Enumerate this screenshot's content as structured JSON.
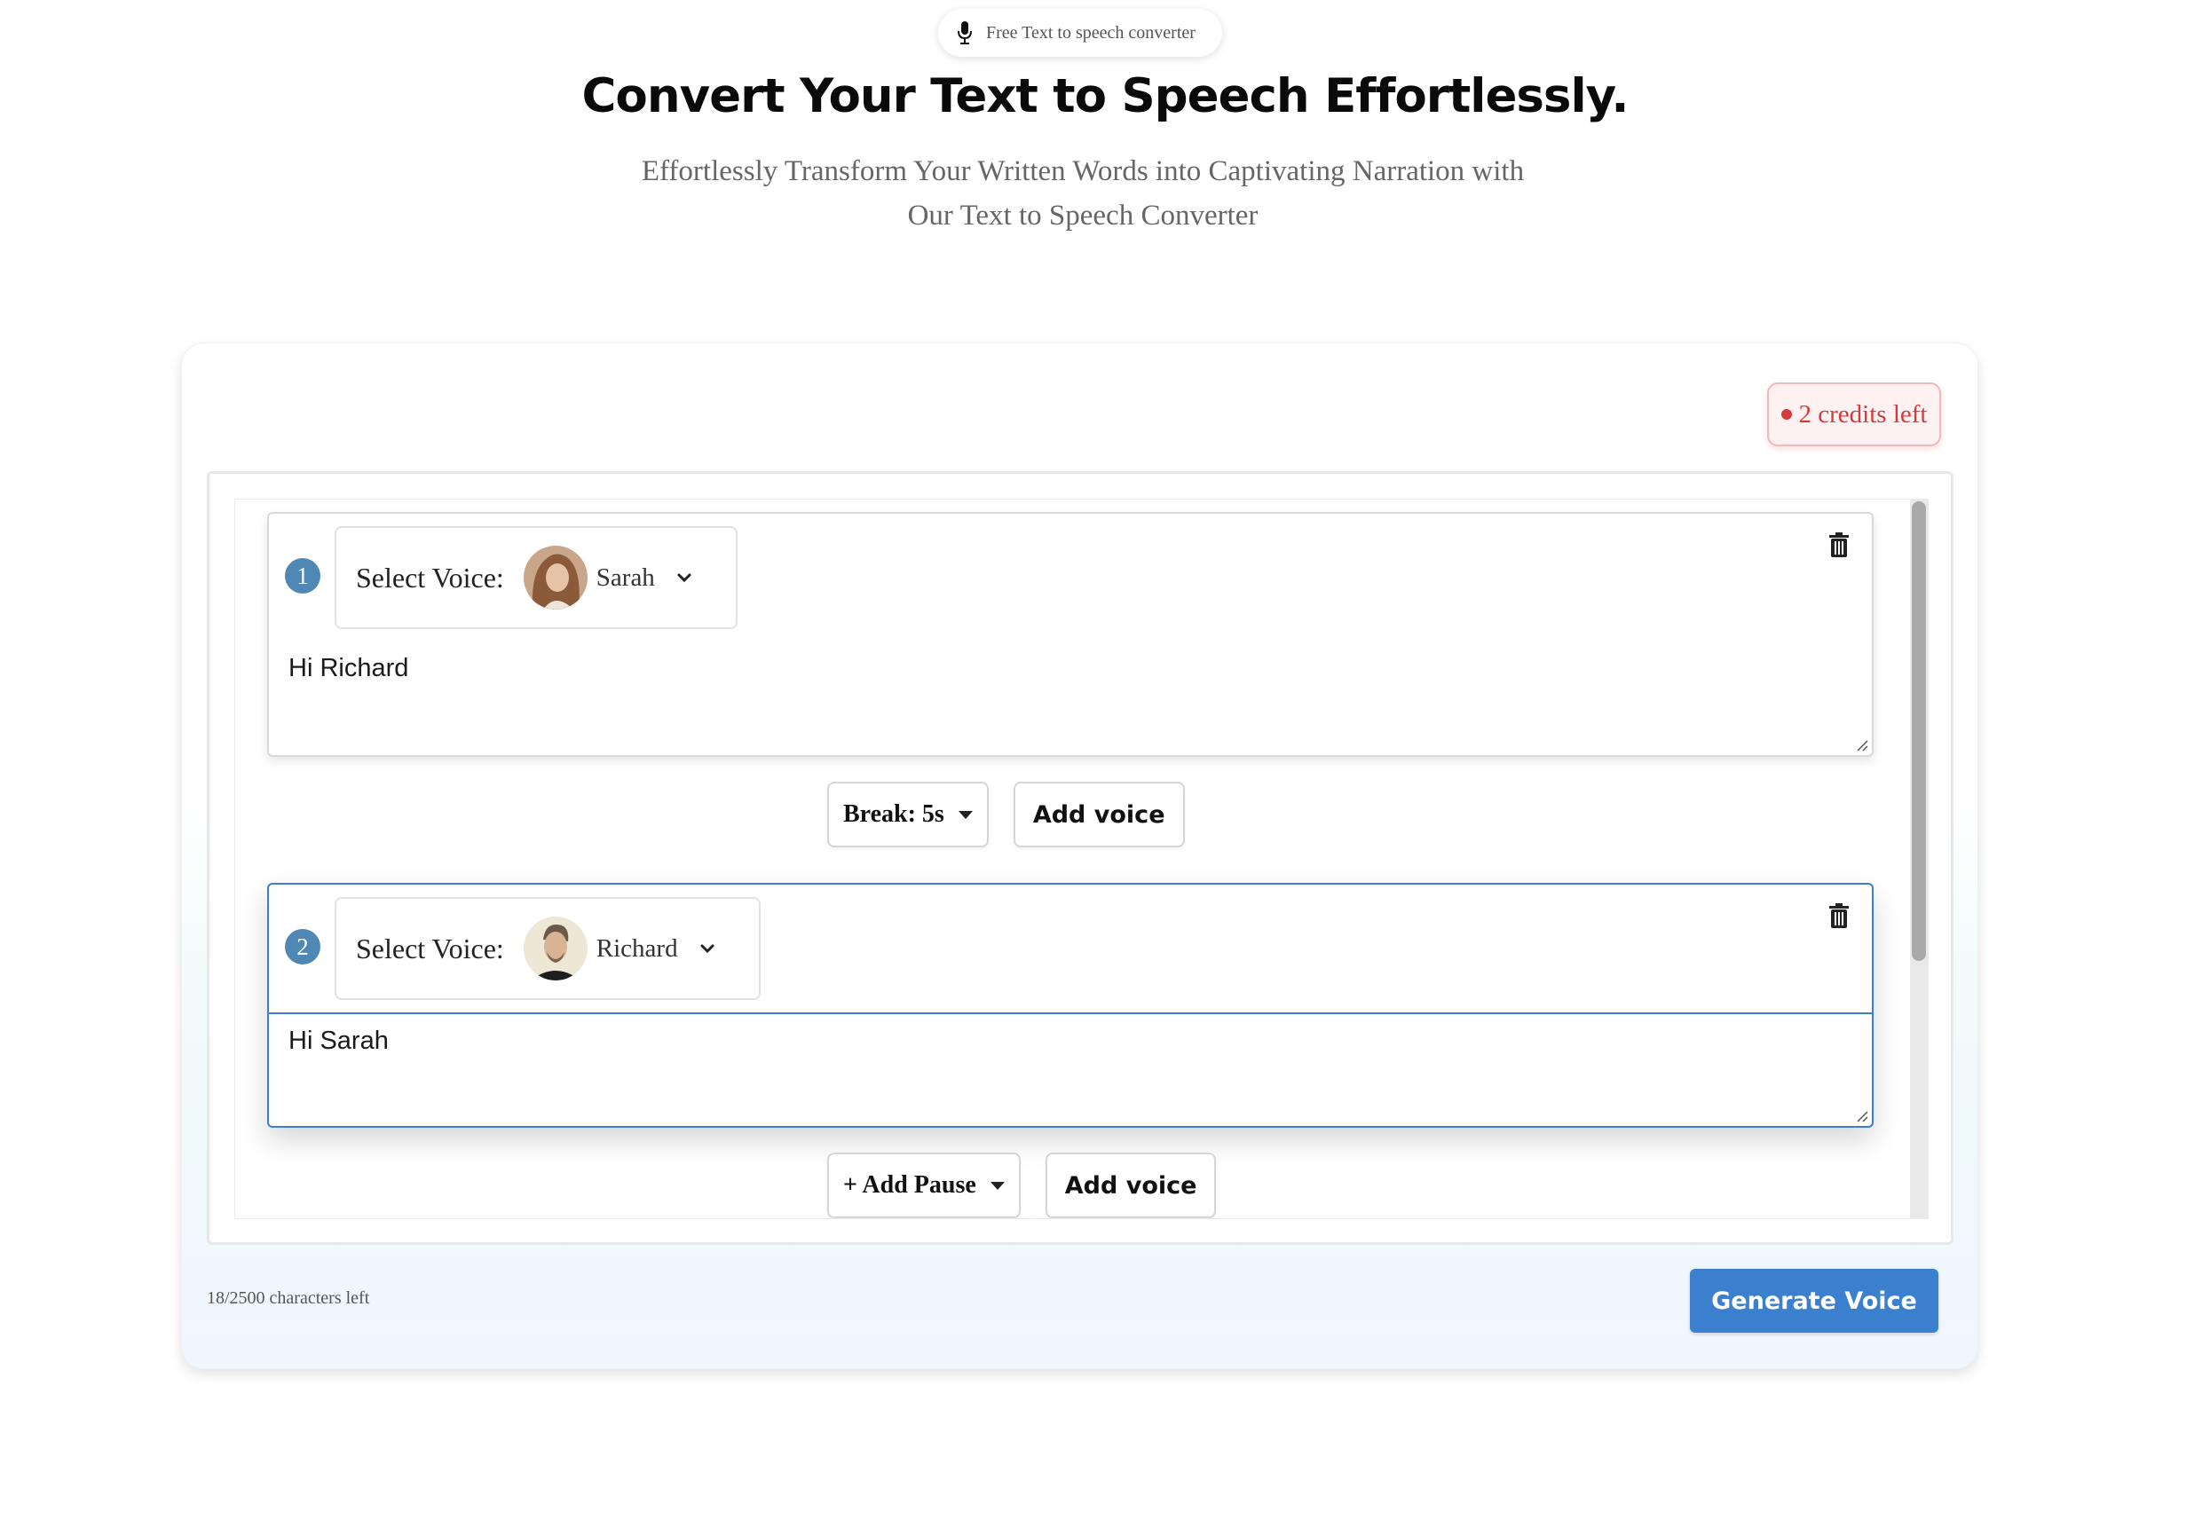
{
  "badge": {
    "label": "Free Text to speech converter",
    "icon": "microphone-icon"
  },
  "hero": {
    "title": "Convert Your Text to Speech Effortlessly.",
    "subtitle": "Effortlessly Transform Your Written Words into Captivating Narration with Our Text to Speech Converter"
  },
  "credits": {
    "label": "2 credits left",
    "color": "#d43b3b"
  },
  "blocks": [
    {
      "number": "1",
      "select_label": "Select Voice:",
      "voice_name": "Sarah",
      "text": "Hi Richard",
      "pause_label": "Break: 5s",
      "add_voice_label": "Add voice"
    },
    {
      "number": "2",
      "select_label": "Select Voice:",
      "voice_name": "Richard",
      "text": "Hi Sarah",
      "pause_label": "+ Add Pause",
      "add_voice_label": "Add voice"
    }
  ],
  "footer": {
    "chars_left": "18/2500 characters left",
    "generate_label": "Generate Voice"
  },
  "colors": {
    "accent": "#3b7fcf",
    "number_badge": "#4f88b4",
    "active_border": "#3d7bd6"
  }
}
